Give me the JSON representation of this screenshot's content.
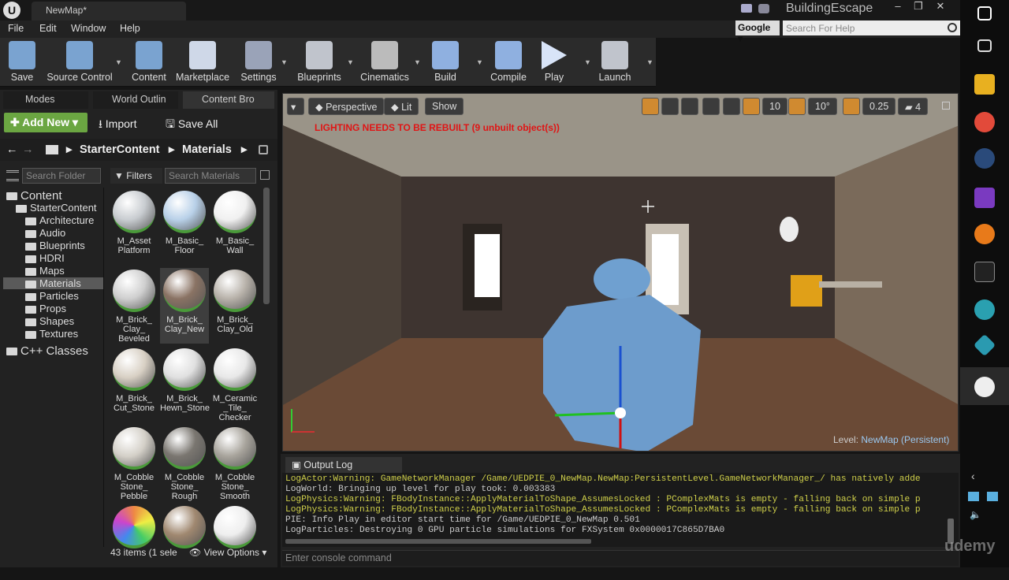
{
  "window": {
    "tab_title": "NewMap*",
    "project": "BuildingEscape",
    "controls": [
      "–",
      "❐",
      "✕"
    ]
  },
  "menu": [
    "File",
    "Edit",
    "Window",
    "Help"
  ],
  "help_search": {
    "engine": "Google",
    "placeholder": "Search For Help"
  },
  "toolbar": [
    {
      "label": "Save",
      "icon": "save-icon",
      "color": "#7aa3d0"
    },
    {
      "label": "Source Control",
      "icon": "source-control-icon",
      "color": "#7aa3d0"
    },
    {
      "label": "Content",
      "icon": "content-icon",
      "color": "#7aa3d0"
    },
    {
      "label": "Marketplace",
      "icon": "marketplace-icon",
      "color": "#cfd8e8"
    },
    {
      "label": "Settings",
      "icon": "settings-icon",
      "color": "#9aa3b8"
    },
    {
      "label": "Blueprints",
      "icon": "blueprints-icon",
      "color": "#c0c4cc"
    },
    {
      "label": "Cinematics",
      "icon": "cinematics-icon",
      "color": "#bbbbbb"
    },
    {
      "label": "Build",
      "icon": "build-icon",
      "color": "#8fb0e0"
    },
    {
      "label": "Compile",
      "icon": "compile-icon",
      "color": "#8fb0e0"
    },
    {
      "label": "Play",
      "icon": "play-icon",
      "color": "#d8e4f8"
    },
    {
      "label": "Launch",
      "icon": "launch-icon",
      "color": "#c0c4cc"
    }
  ],
  "panel_tabs": [
    "Modes",
    "World Outlin",
    "Content Bro"
  ],
  "content_browser": {
    "add_new": "Add New",
    "import": "Import",
    "save_all": "Save All",
    "breadcrumb": [
      "StarterContent",
      "Materials"
    ],
    "folder_search": "Search Folder",
    "filters": "Filters",
    "asset_search": "Search Materials",
    "tree": [
      {
        "label": "Content",
        "level": 0,
        "big": true
      },
      {
        "label": "StarterContent",
        "level": 1
      },
      {
        "label": "Architecture",
        "level": 2
      },
      {
        "label": "Audio",
        "level": 2
      },
      {
        "label": "Blueprints",
        "level": 2
      },
      {
        "label": "HDRI",
        "level": 2
      },
      {
        "label": "Maps",
        "level": 2
      },
      {
        "label": "Materials",
        "level": 2,
        "selected": true
      },
      {
        "label": "Particles",
        "level": 2
      },
      {
        "label": "Props",
        "level": 2
      },
      {
        "label": "Shapes",
        "level": 2
      },
      {
        "label": "Textures",
        "level": 2
      },
      {
        "label": "C++ Classes",
        "level": 0,
        "big": true
      }
    ],
    "assets": [
      {
        "name": "M_Asset Platform",
        "color": "#c8ccd0"
      },
      {
        "name": "M_Basic_ Floor",
        "color": "#b8d0e8"
      },
      {
        "name": "M_Basic_ Wall",
        "color": "#f0f0f0"
      },
      {
        "name": "M_Brick_ Clay_ Beveled",
        "color": "#cfcfcf"
      },
      {
        "name": "M_Brick_ Clay_New",
        "color": "#8a7364"
      },
      {
        "name": "M_Brick_ Clay_Old",
        "color": "#b8b2aa"
      },
      {
        "name": "M_Brick_ Cut_Stone",
        "color": "#d8d0c4"
      },
      {
        "name": "M_Brick_ Hewn_Stone",
        "color": "#e0e0e0"
      },
      {
        "name": "M_Ceramic _Tile_ Checker",
        "color": "#e8e8e8"
      },
      {
        "name": "M_Cobble Stone_ Pebble",
        "color": "#d4d0c8"
      },
      {
        "name": "M_Cobble Stone_ Rough",
        "color": "#7a7670"
      },
      {
        "name": "M_Cobble Stone_ Smooth",
        "color": "#a8a49c"
      },
      {
        "name": "",
        "color": "#e8c040"
      },
      {
        "name": "",
        "color": "#a08870"
      },
      {
        "name": "",
        "color": "#eeeeee"
      }
    ],
    "footer_count": "43 items (1 sele",
    "view_options": "View Options"
  },
  "viewport": {
    "buttons": [
      "Perspective",
      "Lit",
      "Show"
    ],
    "grid": "10",
    "rot": "10°",
    "scale": "0.25",
    "cam_speed": "4",
    "warning": "LIGHTING NEEDS TO BE REBUILT (9 unbuilt object(s))",
    "level_label": "Level:",
    "level_name": "NewMap (Persistent)"
  },
  "output_log": {
    "tab": "Output Log",
    "lines": [
      {
        "text": "LogActor:Warning: GameNetworkManager /Game/UEDPIE_0_NewMap.NewMap:PersistentLevel.GameNetworkManager_/ has natively adde",
        "warn": true
      },
      {
        "text": "LogWorld: Bringing up level for play took: 0.003383",
        "warn": false
      },
      {
        "text": "LogPhysics:Warning: FBodyInstance::ApplyMaterialToShape_AssumesLocked : PComplexMats is empty - falling back on simple p",
        "warn": true
      },
      {
        "text": "LogPhysics:Warning: FBodyInstance::ApplyMaterialToShape_AssumesLocked : PComplexMats is empty - falling back on simple p",
        "warn": true
      },
      {
        "text": "PIE: Info Play in editor start time for /Game/UEDPIE_0_NewMap 0.501",
        "warn": false
      },
      {
        "text": "LogParticles: Destroying 0 GPU particle simulations for FXSystem 0x0000017C865D7BA0",
        "warn": false
      }
    ],
    "console_placeholder": "Enter console command"
  },
  "watermark": "udemy"
}
